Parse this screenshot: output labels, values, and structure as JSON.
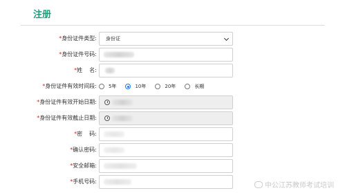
{
  "header": {
    "title": "注册"
  },
  "form": {
    "required_mark": "*",
    "id_type": {
      "label": "身份证件类型:",
      "value": "身份证"
    },
    "id_number": {
      "label": "身份证件号码:"
    },
    "name": {
      "label": "姓    名:"
    },
    "validity": {
      "label": "身份证件有效时间段:",
      "options": [
        "5年",
        "10年",
        "20年",
        "长期"
      ],
      "selected": "10年"
    },
    "valid_start": {
      "label": "身份证件有效开始日期:"
    },
    "valid_end": {
      "label": "身份证件有效截止日期:"
    },
    "password": {
      "label": "密    码:"
    },
    "confirm_password": {
      "label": "确认密码:"
    },
    "email": {
      "label": "安全邮箱:"
    },
    "phone": {
      "label": "手机号码:"
    }
  },
  "watermark": {
    "text": "中公江苏教师考试培训"
  },
  "colors": {
    "accent": "#1a9e7a",
    "required": "#e02020",
    "radio_selected": "#1e6fff"
  }
}
